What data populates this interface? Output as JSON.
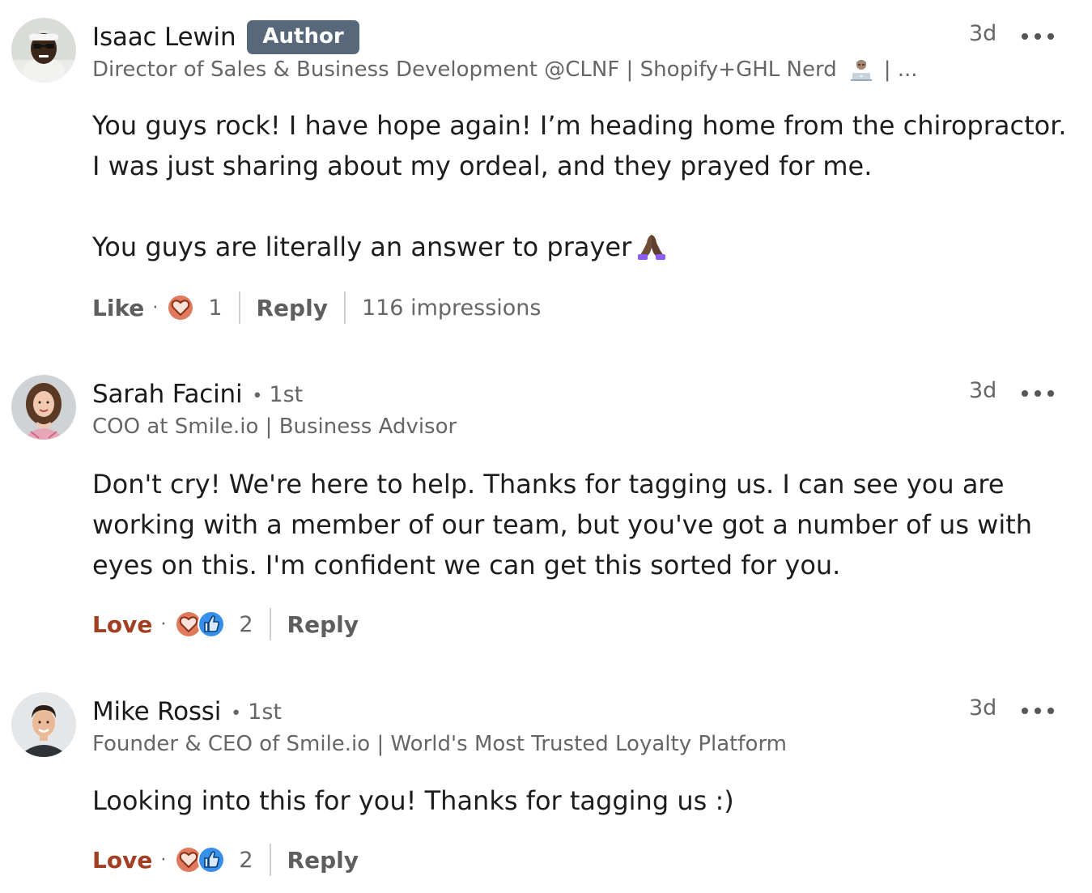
{
  "comments": [
    {
      "name": "Isaac Lewin",
      "badge": "Author",
      "degree": "",
      "headline": "Director of Sales & Business Development @CLNF | Shopify+GHL Nerd",
      "headline_suffix": "| ...",
      "time": "3d",
      "body": [
        "You guys rock! I have hope again! I’m heading home from the chiropractor. I was just sharing about my ordeal, and they prayed for me.",
        "You guys are literally an answer to prayer"
      ],
      "reaction_label": "Like",
      "reaction_count": "1",
      "reply_label": "Reply",
      "impressions": "116 impressions"
    },
    {
      "name": "Sarah Facini",
      "badge": "",
      "degree": "1st",
      "headline": "COO at Smile.io | Business Advisor",
      "time": "3d",
      "body": [
        "Don't cry! We're here to help. Thanks for tagging us. I can see you are working with a member of our team, but you've got a number of us with eyes on this. I'm confident we can get this sorted for you."
      ],
      "reaction_label": "Love",
      "reaction_count": "2",
      "reply_label": "Reply"
    },
    {
      "name": "Mike Rossi",
      "badge": "",
      "degree": "1st",
      "headline": "Founder & CEO of Smile.io | World's Most Trusted Loyalty Platform",
      "time": "3d",
      "body": [
        "Looking into this for you! Thanks for tagging us :)"
      ],
      "reaction_label": "Love",
      "reaction_count": "2",
      "reply_label": "Reply"
    }
  ],
  "icons": {
    "more": "more-options-icon",
    "love": "love-reaction-icon",
    "like": "like-reaction-icon",
    "pray_emoji": "folded-hands-emoji",
    "laptop_emoji": "technologist-emoji"
  },
  "colors": {
    "badge_bg": "#56687a",
    "love_text": "#a23f22",
    "love_icon": "#e07a5f",
    "like_icon": "#378fe9"
  }
}
